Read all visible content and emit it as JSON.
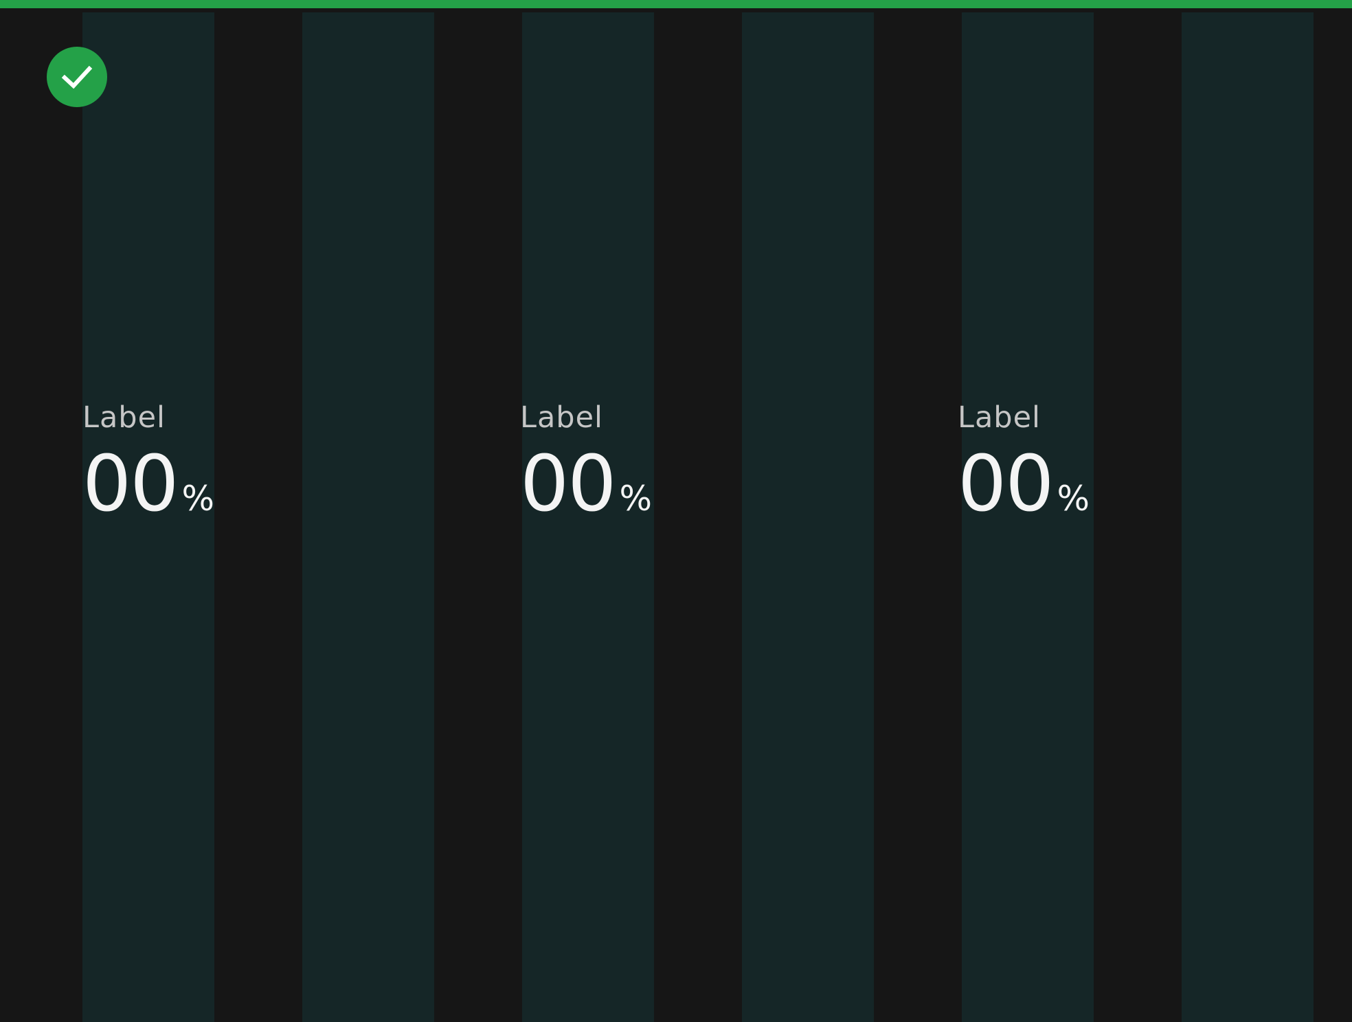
{
  "colors": {
    "background": "#161616",
    "accent": "#24a148",
    "column": "#152627",
    "label_text": "#c6c6c6",
    "value_text": "#f4f4f4"
  },
  "status_icon": "checkmark-icon",
  "stats": [
    {
      "label": "Label",
      "value": "00",
      "unit": "%"
    },
    {
      "label": "Label",
      "value": "00",
      "unit": "%"
    },
    {
      "label": "Label",
      "value": "00",
      "unit": "%"
    }
  ]
}
